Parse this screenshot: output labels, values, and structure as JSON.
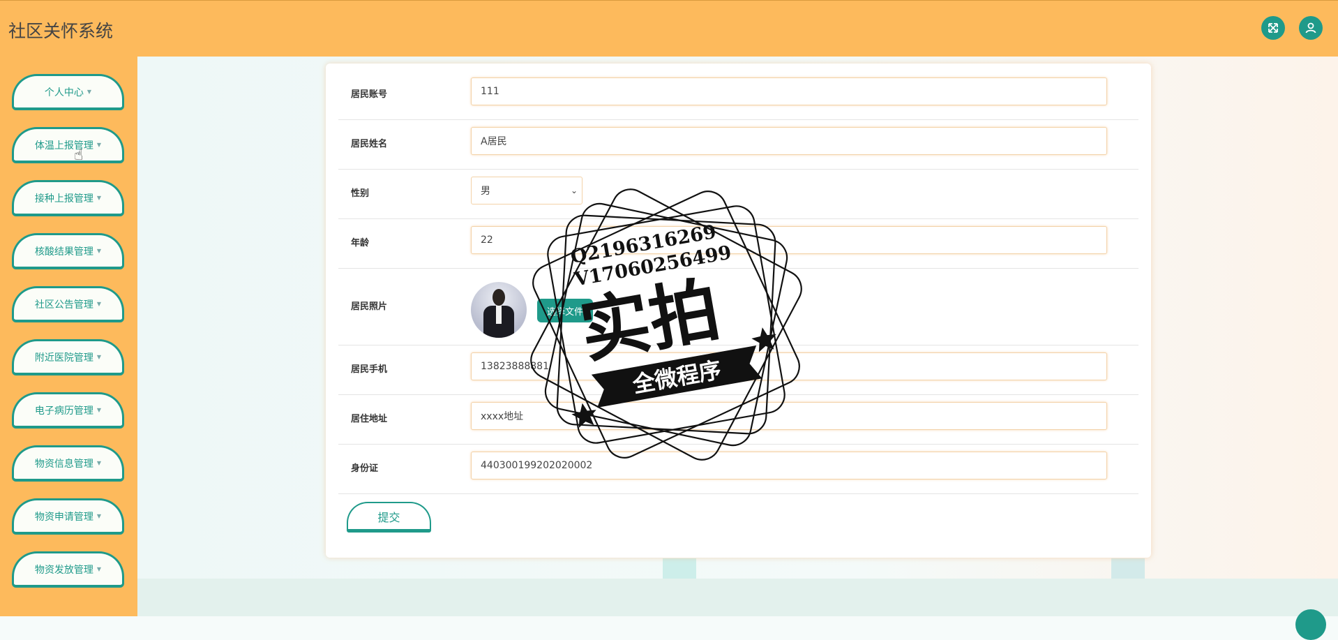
{
  "app": {
    "title": "社区关怀系统"
  },
  "header": {
    "icons": [
      "fullscreen-icon",
      "user-icon"
    ]
  },
  "sidebar": {
    "items": [
      {
        "label": "个人中心"
      },
      {
        "label": "体温上报管理"
      },
      {
        "label": "接种上报管理"
      },
      {
        "label": "核酸结果管理"
      },
      {
        "label": "社区公告管理"
      },
      {
        "label": "附近医院管理"
      },
      {
        "label": "电子病历管理"
      },
      {
        "label": "物资信息管理"
      },
      {
        "label": "物资申请管理"
      },
      {
        "label": "物资发放管理"
      }
    ]
  },
  "form": {
    "account": {
      "label": "居民账号",
      "value": "111"
    },
    "name": {
      "label": "居民姓名",
      "value": "A居民"
    },
    "gender": {
      "label": "性别",
      "value": "男"
    },
    "age": {
      "label": "年龄",
      "value": "22"
    },
    "photo": {
      "label": "居民照片",
      "button": "选择文件"
    },
    "phone": {
      "label": "居民手机",
      "value": "13823888881"
    },
    "address": {
      "label": "居住地址",
      "value": "xxxx地址"
    },
    "idcard": {
      "label": "身份证",
      "value": "440300199202020002"
    },
    "submit": "提交"
  },
  "watermark": {
    "line1": "Q2196316269",
    "line2": "V17060256499",
    "main": "实拍",
    "banner": "全微程序"
  },
  "colors": {
    "accent": "#1f9a8a",
    "header": "#fdba5c"
  }
}
